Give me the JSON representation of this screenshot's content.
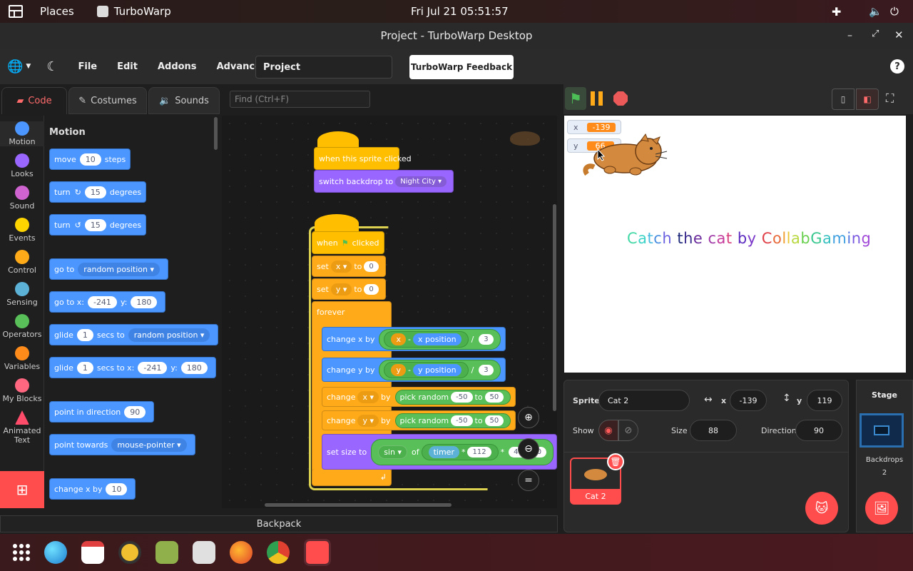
{
  "system": {
    "places": "Places",
    "app_name": "TurboWarp",
    "clock": "Fri Jul 21  05:51:57"
  },
  "window": {
    "title": "Project - TurboWarp Desktop"
  },
  "menu": {
    "file": "File",
    "edit": "Edit",
    "addons": "Addons",
    "advanced": "Advanced",
    "project_title_value": "Project",
    "feedback": "TurboWarp Feedback",
    "help": "?"
  },
  "tabs": {
    "code": "Code",
    "costumes": "Costumes",
    "sounds": "Sounds"
  },
  "find": {
    "placeholder": "Find (Ctrl+F)"
  },
  "categories": [
    {
      "label": "Motion",
      "color": "#4c97ff"
    },
    {
      "label": "Looks",
      "color": "#9966ff"
    },
    {
      "label": "Sound",
      "color": "#cf63cf"
    },
    {
      "label": "Events",
      "color": "#ffd500"
    },
    {
      "label": "Control",
      "color": "#ffab19"
    },
    {
      "label": "Sensing",
      "color": "#5cb1d6"
    },
    {
      "label": "Operators",
      "color": "#59c059"
    },
    {
      "label": "Variables",
      "color": "#ff8c1a"
    },
    {
      "label": "My Blocks",
      "color": "#ff6680"
    },
    {
      "label": "Animated\nText",
      "color": "#ff4c6a"
    }
  ],
  "palette": {
    "heading": "Motion",
    "move": "move",
    "move_val": "10",
    "steps": "steps",
    "turn": "turn",
    "turn_val": "15",
    "degrees": "degrees",
    "goto": "go to",
    "random_position": "random position",
    "gotoxy": "go to x:",
    "gx": "-241",
    "y_label": "y:",
    "gy": "180",
    "glide": "glide",
    "glide_val": "1",
    "secs_to": "secs to",
    "secs_to_x": "secs to x:",
    "point_dir": "point in direction",
    "dir_val": "90",
    "point_towards": "point towards",
    "mouse_pointer": "mouse-pointer",
    "change_x": "change x by",
    "change_x_val": "10"
  },
  "script": {
    "when_sprite_clicked": "when this sprite clicked",
    "switch_backdrop": "switch backdrop to",
    "night_city": "Night City",
    "when": "when",
    "clicked": "clicked",
    "set": "set",
    "x": "x",
    "y": "y",
    "to": "to",
    "zero": "0",
    "forever": "forever",
    "change_x_by": "change x by",
    "change_y_by": "change y by",
    "minus": "-",
    "x_position": "x position",
    "y_position": "y position",
    "div": "/",
    "three": "3",
    "change": "change",
    "by": "by",
    "pick_random": "pick random",
    "neg50": "-50",
    "fifty": "50",
    "set_size": "set size to",
    "sin": "sin",
    "of": "of",
    "timer": "timer",
    "times": "*",
    "v112": "112",
    "v40": "40",
    "v0": "0"
  },
  "stage": {
    "monitor_x_label": "x",
    "monitor_x_val": "-139",
    "monitor_y_label": "y",
    "monitor_y_val": "66",
    "caption": [
      "C",
      "a",
      "t",
      "c",
      "h",
      " ",
      "t",
      "h",
      "e",
      " ",
      "c",
      "a",
      "t",
      " ",
      "b",
      "y",
      " ",
      "C",
      "o",
      "l",
      "l",
      "a",
      "b",
      "G",
      "a",
      "m",
      "i",
      "n",
      "g"
    ],
    "caption_colors": [
      "#44d9a6",
      "#3bd3c7",
      "#4dbbe0",
      "#4a8ee0",
      "#6c63e0",
      "#ffffff",
      "#1e2a7a",
      "#3a2a8c",
      "#6a2a9c",
      "#ffffff",
      "#a03aa8",
      "#c43a9c",
      "#d84080",
      "#ffffff",
      "#5a2ac0",
      "#7a36c8",
      "#ffffff",
      "#e04048",
      "#e86a3a",
      "#f0a030",
      "#e8c83a",
      "#b8d840",
      "#6ad050",
      "#3ac890",
      "#38c0c0",
      "#40a0e0",
      "#5078e0",
      "#7a5ae0",
      "#a048d8"
    ]
  },
  "sprite_info": {
    "sprite_label": "Sprite",
    "sprite_name": "Cat 2",
    "x_label": "x",
    "x_val": "-139",
    "y_label": "y",
    "y_val": "119",
    "show_label": "Show",
    "size_label": "Size",
    "size_val": "88",
    "direction_label": "Direction",
    "direction_val": "90",
    "tile_name": "Cat 2"
  },
  "stage_panel": {
    "title": "Stage",
    "backdrops_label": "Backdrops",
    "backdrops_count": "2"
  },
  "backpack": "Backpack"
}
